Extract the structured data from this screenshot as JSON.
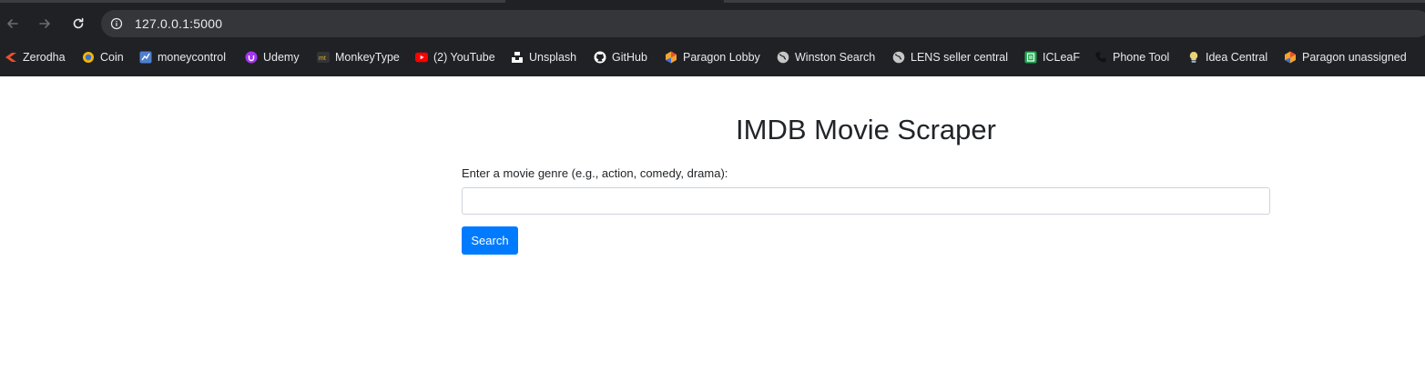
{
  "browser": {
    "url": "127.0.0.1:5000",
    "bookmarks": [
      {
        "label": "Zerodha",
        "icon": "zerodha-icon",
        "color": "#e8502f"
      },
      {
        "label": "Coin",
        "icon": "coin-icon",
        "color": "#f2b705"
      },
      {
        "label": "moneycontrol",
        "icon": "moneycontrol-icon",
        "color": "#4f7fd0"
      },
      {
        "label": "Udemy",
        "icon": "udemy-icon",
        "color": "#a435f0"
      },
      {
        "label": "MonkeyType",
        "icon": "monkeytype-icon",
        "color": "#e2b714"
      },
      {
        "label": "(2) YouTube",
        "icon": "youtube-icon",
        "color": "#ff0000"
      },
      {
        "label": "Unsplash",
        "icon": "unsplash-icon",
        "color": "#ffffff"
      },
      {
        "label": "GitHub",
        "icon": "github-icon",
        "color": "#ffffff"
      },
      {
        "label": "Paragon Lobby",
        "icon": "paragon-icon",
        "color": "#f4a42b"
      },
      {
        "label": "Winston Search",
        "icon": "globe-icon",
        "color": "#c4c7c5"
      },
      {
        "label": "LENS seller central",
        "icon": "globe-icon",
        "color": "#c4c7c5"
      },
      {
        "label": "ICLeaF",
        "icon": "icleaf-icon",
        "color": "#1fa84f"
      },
      {
        "label": "Phone Tool",
        "icon": "phone-icon",
        "color": "#222222"
      },
      {
        "label": "Idea Central",
        "icon": "lightbulb-icon",
        "color": "#9ab0c8"
      },
      {
        "label": "Paragon unassigned",
        "icon": "paragon-icon",
        "color": "#f4a42b"
      }
    ]
  },
  "page": {
    "title": "IMDB Movie Scraper",
    "genre_label": "Enter a movie genre (e.g., action, comedy, drama):",
    "genre_value": "",
    "search_label": "Search"
  },
  "colors": {
    "primary": "#007bff",
    "chrome_bg": "#202124",
    "omnibox_bg": "#35363a"
  }
}
